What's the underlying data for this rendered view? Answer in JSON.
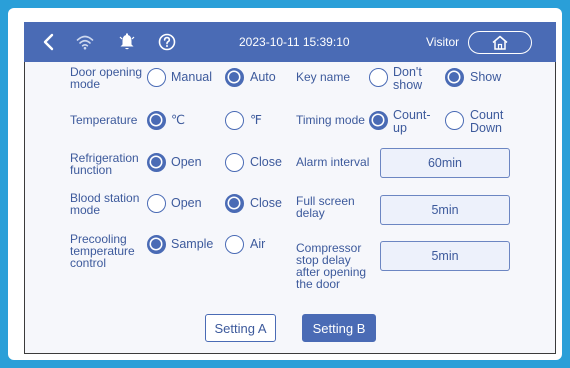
{
  "header": {
    "datetime": "2023-10-11 15:39:10",
    "user": "Visitor",
    "icons": [
      "back-icon",
      "wifi-icon",
      "alarm-bell-icon",
      "help-icon",
      "home-icon"
    ]
  },
  "settings": {
    "door_opening_mode": {
      "label": "Door opening mode",
      "options": [
        "Manual",
        "Auto"
      ],
      "selected": "Auto"
    },
    "temperature": {
      "label": "Temperature",
      "options": [
        "℃",
        "℉"
      ],
      "selected": "℃"
    },
    "refrigeration_function": {
      "label": "Refrigeration function",
      "options": [
        "Open",
        "Close"
      ],
      "selected": "Open"
    },
    "blood_station_mode": {
      "label": "Blood station mode",
      "options": [
        "Open",
        "Close"
      ],
      "selected": "Close"
    },
    "precooling_temperature_control": {
      "label": "Precooling temperature control",
      "options": [
        "Sample",
        "Air"
      ],
      "selected": "Sample"
    },
    "key_name": {
      "label": "Key name",
      "options": [
        "Don't show",
        "Show"
      ],
      "selected": "Show"
    },
    "timing_mode": {
      "label": "Timing mode",
      "options": [
        "Count-up",
        "Count Down"
      ],
      "selected": "Count-up"
    },
    "alarm_interval": {
      "label": "Alarm interval",
      "value": "60min"
    },
    "full_screen_delay": {
      "label": "Full screen delay",
      "value": "5min"
    },
    "compressor_stop_delay": {
      "label": "Compressor stop delay after opening the door",
      "value": "5min"
    }
  },
  "footer": {
    "setting_a": "Setting A",
    "setting_b": "Setting B",
    "active": "Setting B"
  },
  "colors": {
    "accent": "#4a6bb5",
    "label_text": "#3d5a9c",
    "border": "#2a9fd8"
  }
}
